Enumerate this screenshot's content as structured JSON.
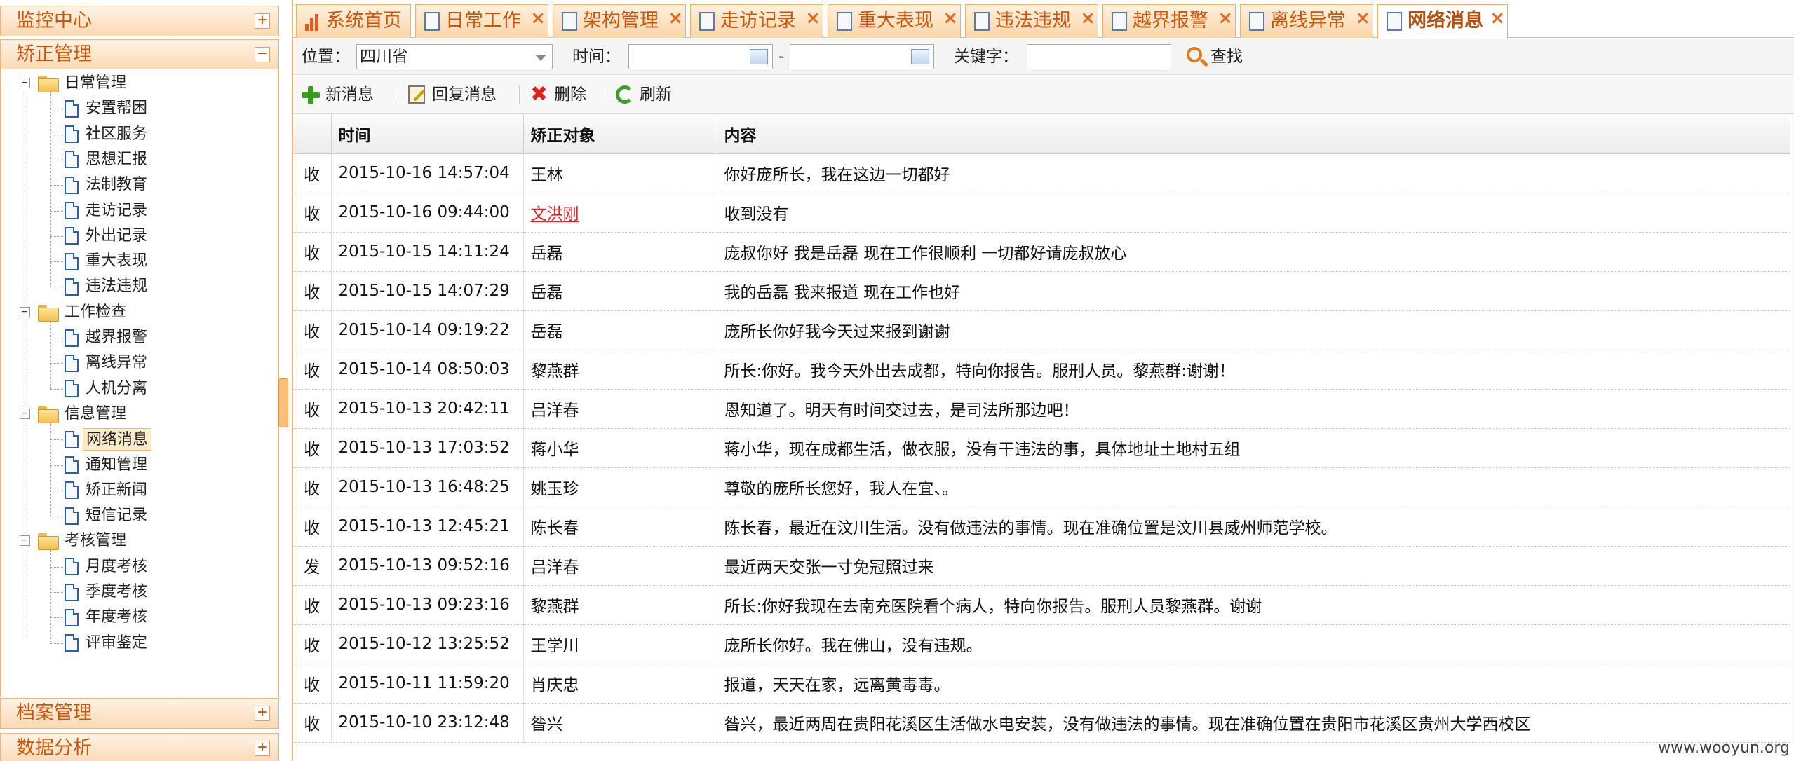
{
  "left_panel": {
    "accordion": [
      {
        "title": "监控中心",
        "state": "+"
      },
      {
        "title": "矫正管理",
        "state": "−"
      },
      {
        "title": "档案管理",
        "state": "+"
      },
      {
        "title": "数据分析",
        "state": "+"
      }
    ],
    "tree": [
      {
        "label": "日常管理",
        "children": [
          "安置帮困",
          "社区服务",
          "思想汇报",
          "法制教育",
          "走访记录",
          "外出记录",
          "重大表现",
          "违法违规"
        ]
      },
      {
        "label": "工作检查",
        "children": [
          "越界报警",
          "离线异常",
          "人机分离"
        ]
      },
      {
        "label": "信息管理",
        "children": [
          "网络消息",
          "通知管理",
          "矫正新闻",
          "短信记录"
        ]
      },
      {
        "label": "考核管理",
        "children": [
          "月度考核",
          "季度考核",
          "年度考核",
          "评审鉴定"
        ]
      }
    ],
    "selected": "网络消息"
  },
  "tabs": [
    "系统首页",
    "日常工作",
    "架构管理",
    "走访记录",
    "重大表现",
    "违法违规",
    "越界报警",
    "离线异常",
    "网络消息"
  ],
  "active_tab": "网络消息",
  "filter": {
    "location_label": "位置：",
    "location_value": "四川省",
    "time_label": "时间：",
    "time_from": "",
    "time_sep": "-",
    "time_to": "",
    "keyword_label": "关键字：",
    "keyword_value": "",
    "search_label": "查找"
  },
  "toolbar": {
    "new_label": "新消息",
    "reply_label": "回复消息",
    "delete_label": "删除",
    "refresh_label": "刷新"
  },
  "grid": {
    "columns": [
      "",
      "时间",
      "矫正对象",
      "内容"
    ],
    "rows": [
      {
        "dir": "收",
        "time": "2015-10-16 14:57:04",
        "person": "王林",
        "content": "你好庞所长，我在这边一切都好"
      },
      {
        "dir": "收",
        "time": "2015-10-16 09:44:00",
        "person": "文洪刚",
        "content": "收到没有",
        "link": true
      },
      {
        "dir": "收",
        "time": "2015-10-15 14:11:24",
        "person": "岳磊",
        "content": "庞叔你好 我是岳磊 现在工作很顺利 一切都好请庞叔放心"
      },
      {
        "dir": "收",
        "time": "2015-10-15 14:07:29",
        "person": "岳磊",
        "content": "我的岳磊 我来报道 现在工作也好"
      },
      {
        "dir": "收",
        "time": "2015-10-14 09:19:22",
        "person": "岳磊",
        "content": "庞所长你好我今天过来报到谢谢"
      },
      {
        "dir": "收",
        "time": "2015-10-14 08:50:03",
        "person": "黎燕群",
        "content": "所长:你好。我今天外出去成都，特向你报告。服刑人员。黎燕群:谢谢！"
      },
      {
        "dir": "收",
        "time": "2015-10-13 20:42:11",
        "person": "吕洋春",
        "content": "恩知道了。明天有时间交过去，是司法所那边吧！"
      },
      {
        "dir": "收",
        "time": "2015-10-13 17:03:52",
        "person": "蒋小华",
        "content": "蒋小华，现在成都生活，做衣服，没有干违法的事，具体地址土地村五组"
      },
      {
        "dir": "收",
        "time": "2015-10-13 16:48:25",
        "person": "姚玉珍",
        "content": "尊敬的庞所长您好，我人在宜、。"
      },
      {
        "dir": "收",
        "time": "2015-10-13 12:45:21",
        "person": "陈长春",
        "content": "陈长春，最近在汶川生活。没有做违法的事情。现在准确位置是汶川县威州师范学校。"
      },
      {
        "dir": "发",
        "time": "2015-10-13 09:52:16",
        "person": "吕洋春",
        "content": "最近两天交张一寸免冠照过来"
      },
      {
        "dir": "收",
        "time": "2015-10-13 09:23:16",
        "person": "黎燕群",
        "content": "所长:你好我现在去南充医院看个病人，特向你报告。服刑人员黎燕群。谢谢"
      },
      {
        "dir": "收",
        "time": "2015-10-12 13:25:52",
        "person": "王学川",
        "content": "庞所长你好。我在佛山，没有违规。"
      },
      {
        "dir": "收",
        "time": "2015-10-11 11:59:20",
        "person": "肖庆忠",
        "content": "报道，天天在家，远离黄毒毒。"
      },
      {
        "dir": "收",
        "time": "2015-10-10 23:12:48",
        "person": "昝兴",
        "content": "昝兴，最近两周在贵阳花溪区生活做水电安装，没有做违法的事情。现在准确位置在贵阳市花溪区贵州大学西校区"
      }
    ]
  },
  "watermark": "www.wooyun.org",
  "colors": {
    "accent": "#c8560c",
    "border": "#f0b578",
    "link": "#dd2222"
  }
}
